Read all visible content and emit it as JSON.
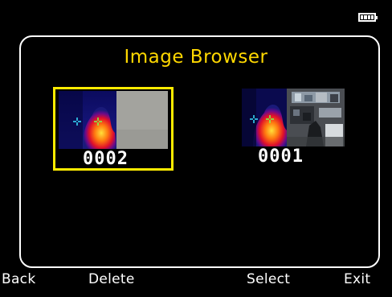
{
  "title": "Image Browser",
  "battery": {
    "icon": "battery-full-icon",
    "level": 1.0
  },
  "images": [
    {
      "label": "0002",
      "selected": true
    },
    {
      "label": "0001",
      "selected": false
    }
  ],
  "softkeys": {
    "back": "Back",
    "delete": "Delete",
    "select": "Select",
    "exit": "Exit"
  },
  "colors": {
    "accent": "#ffd800",
    "selection": "#ffeb00",
    "background": "#000000",
    "text": "#ffffff"
  }
}
